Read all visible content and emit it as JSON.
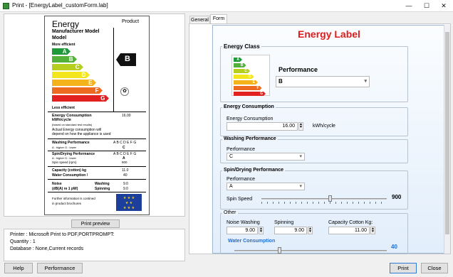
{
  "window": {
    "title": "Print - [EnergyLabel_customForm.lab]",
    "min": "—",
    "max": "☐",
    "close": "✕"
  },
  "label": {
    "energy": "Energy",
    "product": "Product",
    "manufacturer": "Manufacturer Model",
    "model": "Model",
    "more_efficient": "More efficient",
    "less_efficient": "Less efficient",
    "bars": [
      {
        "letter": "A",
        "color": "#1e9a3a"
      },
      {
        "letter": "B",
        "color": "#53b13a"
      },
      {
        "letter": "C",
        "color": "#b6cf1f"
      },
      {
        "letter": "D",
        "color": "#f3e61c"
      },
      {
        "letter": "E",
        "color": "#f4b31a"
      },
      {
        "letter": "F",
        "color": "#ec6b20"
      },
      {
        "letter": "G",
        "color": "#e2201f"
      }
    ],
    "selected_class": "B",
    "consumption_title": "Energy Consumption",
    "consumption_unit": "kWh/cycle",
    "consumption_value": "16.00",
    "consumption_note": "(based on standard test results)",
    "consumption_text1": "Actual Energy consumption will",
    "consumption_text2": "depend on how the appliance is used",
    "washing_title": "Washing Performance",
    "washing_scale": "A : higher  G : lower",
    "washing_letters": "A B C D E F G",
    "washing_value": "C",
    "spin_title": "Spin/Drying Performance",
    "spin_scale": "A : higher  G : lower",
    "spin_speed_label": "Spin speed (rpm)",
    "spin_letters": "A B C D E F G",
    "spin_value": "A",
    "spin_speed_value": "900",
    "capacity_label": "Capacity (cotton) kg",
    "capacity_value": "11.0",
    "water_label": "Water Consumption /",
    "water_value": "40",
    "noise_label": "Noise",
    "noise_unit": "(dB(A)  re 1 pW)",
    "noise_washing": "Washing",
    "noise_washing_val": "9.0",
    "noise_spinning": "Spinning",
    "noise_spinning_val": "9.0",
    "further1": "Further information is contined",
    "further2": "in product brochures"
  },
  "preview_button": "Print preview",
  "info": {
    "printer": "Printer : Microsoft Print to PDF,PORTPROMPT:",
    "quantity": "Quantity : 1",
    "database": "Database : None,Current records"
  },
  "tabs": [
    "General",
    "Form"
  ],
  "form": {
    "title": "Energy Label",
    "energy_class": "Energy Class",
    "performance_label": "Performance",
    "performance_value": "B",
    "consumption_group": "Energy Consumption",
    "consumption_label": "Energy Consumption",
    "consumption_value": "16.00",
    "consumption_unit": "kWh/cycle",
    "washing_group": "Washing Performance",
    "washing_label": "Performance",
    "washing_value": "C",
    "spin_group": "Spin/Drying Performance",
    "spin_perf_label": "Performance",
    "spin_perf_value": "A",
    "spin_speed_label": "Spin Speed",
    "spin_speed_value": "900",
    "spin_speed_fraction": 0.55,
    "other_group": "Other",
    "noise_washing_label": "Noise Washing",
    "noise_washing_value": "9.00",
    "spinning_label": "Spinning",
    "spinning_value": "9.00",
    "capacity_label": "Capacity Cotton Kg:",
    "capacity_value": "11.00",
    "water_label": "Water Consumption",
    "water_value": "40",
    "water_fraction": 0.3
  },
  "footer": {
    "help": "Help",
    "performance": "Performance",
    "print": "Print",
    "close": "Close"
  },
  "colors": {
    "title_red": "#e01b1b",
    "water_blue": "#1f6fd6",
    "selected_arrow": "#111111"
  }
}
